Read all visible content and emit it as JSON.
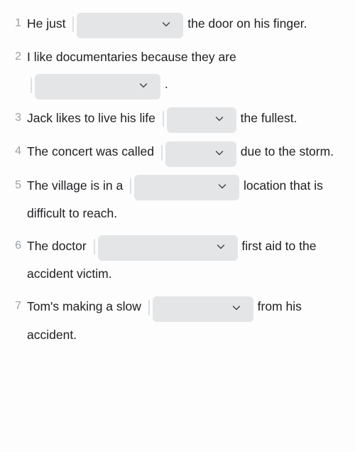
{
  "page": {
    "background_color": "#fdfdfd",
    "text_color": "#202124",
    "number_color": "#9aa0a6",
    "dropdown_border_color": "#dcdfe3",
    "dropdown_shadow_color": "#e4e5e7",
    "dropdown_fill_color": "#ffffff"
  },
  "questions": [
    {
      "number": "1",
      "before": "He just",
      "after": "the door on his finger.",
      "dropdown": {
        "value": "",
        "width": 150,
        "icon": "chevron-down-icon"
      }
    },
    {
      "number": "2",
      "before": "I like documentaries because they are",
      "after": ".",
      "dropdown": {
        "value": "",
        "width": 177,
        "icon": "chevron-down-icon"
      }
    },
    {
      "number": "3",
      "before": "Jack likes to live his life",
      "after": "the fullest.",
      "dropdown": {
        "value": "",
        "width": 98,
        "icon": "chevron-down-icon"
      }
    },
    {
      "number": "4",
      "before": "The concert was called",
      "after": "due to the storm.",
      "dropdown": {
        "value": "",
        "width": 100,
        "icon": "chevron-down-icon"
      }
    },
    {
      "number": "5",
      "before": "The village is in a",
      "after": "location that is difficult to reach.",
      "dropdown": {
        "value": "",
        "width": 148,
        "icon": "chevron-down-icon"
      }
    },
    {
      "number": "6",
      "before": "The doctor",
      "after": "first aid to the accident victim.",
      "dropdown": {
        "value": "",
        "width": 197,
        "icon": "chevron-down-icon"
      }
    },
    {
      "number": "7",
      "before": "Tom's making a slow",
      "after": "from his accident.",
      "dropdown": {
        "value": "",
        "width": 142,
        "icon": "chevron-down-icon"
      }
    }
  ]
}
